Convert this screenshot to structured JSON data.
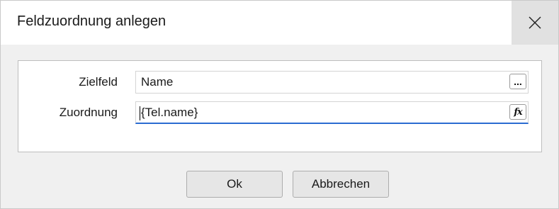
{
  "window": {
    "title": "Feldzuordnung anlegen",
    "close_icon": "close-icon"
  },
  "form": {
    "zielfeld": {
      "label": "Zielfeld",
      "value": "Name",
      "button_label": "..."
    },
    "zuordnung": {
      "label": "Zuordnung",
      "value": "{Tel.name}",
      "button_icon": "function-icon",
      "button_label": "fx"
    }
  },
  "buttons": {
    "ok": "Ok",
    "cancel": "Abbrechen"
  },
  "colors": {
    "focus_underline": "#2b6cd1",
    "close_hover_bg": "#e1e1e1"
  }
}
